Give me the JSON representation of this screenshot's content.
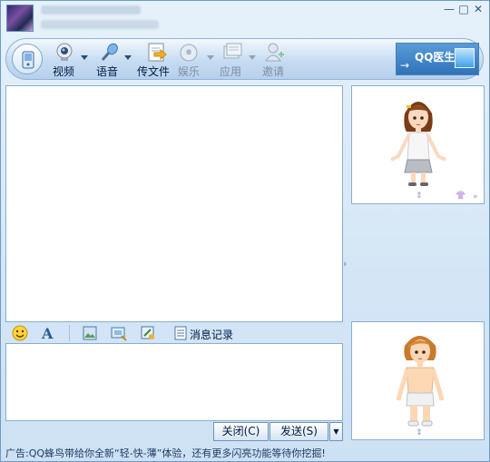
{
  "window": {
    "controls": {
      "minimize": "—",
      "maximize": "□",
      "close": "✕"
    }
  },
  "toolbar": {
    "items": [
      {
        "label": "视频",
        "icon": "webcam-icon"
      },
      {
        "label": "语音",
        "icon": "microphone-icon"
      },
      {
        "label": "传文件",
        "icon": "send-file-icon"
      },
      {
        "label": "娱乐",
        "icon": "soccer-ball-icon"
      },
      {
        "label": "应用",
        "icon": "apps-icon"
      },
      {
        "label": "邀请",
        "icon": "invite-user-icon"
      }
    ],
    "qq_doctor": "QQ医生"
  },
  "format_bar": {
    "history_label": "消息记录"
  },
  "buttons": {
    "close": "关闭(C)",
    "send": "发送(S)",
    "send_dropdown": "▼"
  },
  "ad_text": "广告:QQ蜂鸟带给你全新“轻-快-薄”体验，还有更多闪亮功能等待你挖掘!"
}
